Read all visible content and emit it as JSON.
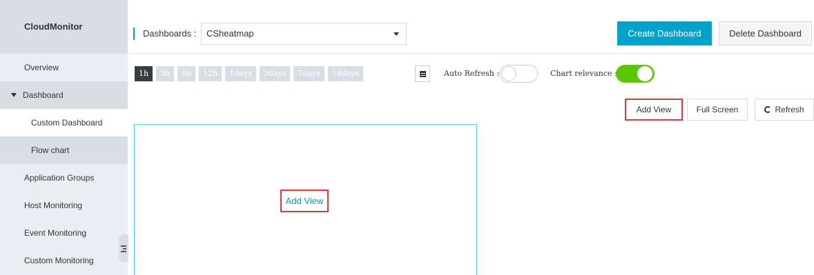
{
  "sidebar": {
    "title": "CloudMonitor",
    "items": [
      {
        "label": "Overview"
      },
      {
        "label": "Dashboard"
      },
      {
        "label": "Custom Dashboard"
      },
      {
        "label": "Flow chart"
      },
      {
        "label": "Application Groups"
      },
      {
        "label": "Host Monitoring"
      },
      {
        "label": "Event Monitoring"
      },
      {
        "label": "Custom Monitoring"
      }
    ]
  },
  "header": {
    "dashboards_label": "Dashboards :",
    "selected_dashboard": "CSheatmap",
    "create_label": "Create Dashboard",
    "delete_label": "Delete Dashboard"
  },
  "toolbar": {
    "ranges": [
      "1h",
      "3h",
      "6h",
      "12h",
      "1days",
      "3days",
      "7days",
      "14days"
    ],
    "active_range": "1h",
    "auto_refresh_label": "Auto Refresh :",
    "auto_refresh_on": false,
    "chart_relevance_label": "Chart relevance :",
    "chart_relevance_on": true
  },
  "actions": {
    "add_view": "Add View",
    "full_screen": "Full Screen",
    "refresh": "Refresh"
  },
  "panel": {
    "add_view": "Add View"
  },
  "colors": {
    "accent": "#00a2ca",
    "toggle_on": "#5ac800",
    "highlight_box": "#e0303a",
    "link": "#0099cc"
  }
}
